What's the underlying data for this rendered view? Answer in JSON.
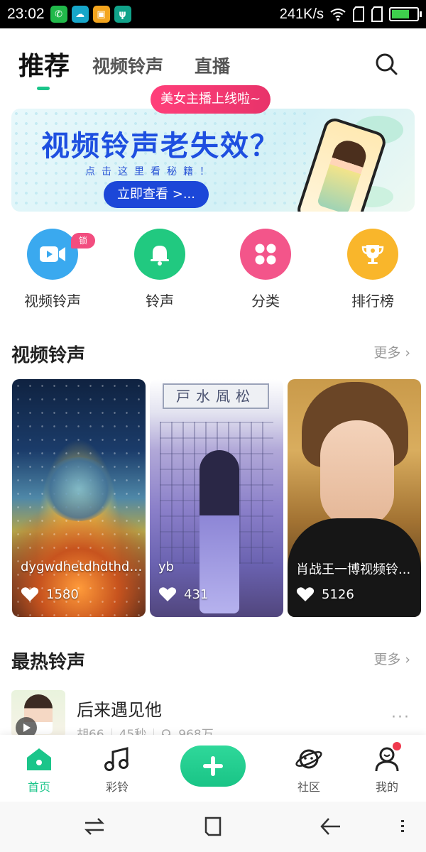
{
  "status_bar": {
    "time": "23:02",
    "speed": "241K/s",
    "battery_level": 0.7,
    "app_icons": [
      "wechat-icon",
      "cloud-icon",
      "photo-icon",
      "usb-icon"
    ]
  },
  "tabs": [
    {
      "label": "推荐",
      "active": true
    },
    {
      "label": "视频铃声",
      "active": false
    },
    {
      "label": "直播",
      "active": false
    }
  ],
  "live_badge": "美女主播上线啦~",
  "banner": {
    "headline": "视频铃声老失效？",
    "sub": "点击这里看秘籍！",
    "cta": "立即查看 >..."
  },
  "categories": [
    {
      "label": "视频铃声",
      "icon": "video-camera-icon",
      "color": "#3aa9ef",
      "badge": "锁屏壁纸"
    },
    {
      "label": "铃声",
      "icon": "bell-icon",
      "color": "#21c980"
    },
    {
      "label": "分类",
      "icon": "grid-icon",
      "color": "#f3558a"
    },
    {
      "label": "排行榜",
      "icon": "trophy-icon",
      "color": "#f9b62b"
    }
  ],
  "video_section": {
    "title": "视频铃声",
    "more": "更多 ›",
    "cards": [
      {
        "title": "dygwdhetdhdthdy...",
        "likes": "1580"
      },
      {
        "title": "yb",
        "likes": "431",
        "sign_text": "戸水凮松"
      },
      {
        "title": "肖战王一博视频铃...",
        "likes": "5126"
      }
    ]
  },
  "hot_section": {
    "title": "最热铃声",
    "more": "更多 ›",
    "songs": [
      {
        "name": "后来遇见他",
        "artist": "胡66",
        "duration": "45秒",
        "plays": "968万"
      }
    ]
  },
  "bottom_nav": [
    {
      "label": "首页",
      "icon": "home-icon",
      "active": true
    },
    {
      "label": "彩铃",
      "icon": "music-note-icon",
      "active": false
    },
    {
      "label": "",
      "icon": "plus-icon",
      "active": false
    },
    {
      "label": "社区",
      "icon": "planet-icon",
      "active": false
    },
    {
      "label": "我的",
      "icon": "user-icon",
      "active": false,
      "has_dot": true
    }
  ],
  "colors": {
    "accent": "#1bc58a",
    "live_badge": "#ef3c70",
    "banner_blue": "#1e4fe0"
  }
}
